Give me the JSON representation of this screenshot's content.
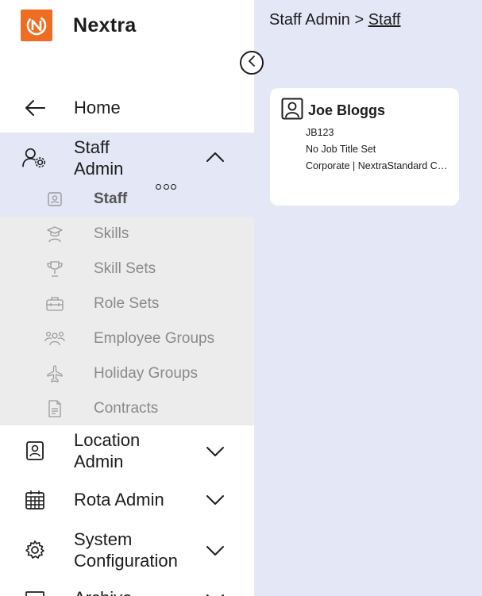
{
  "brand": {
    "name": "Nextra",
    "logo_icon": "nextra-logo-icon",
    "accent": "#ef6d22"
  },
  "sidebar": {
    "collapse_icon": "chevron-left-icon",
    "home": {
      "label": "Home",
      "icon": "arrow-left-icon"
    },
    "staff_admin": {
      "label_line1": "Staff",
      "label_line2": "Admin",
      "icon": "user-gear-icon",
      "expanded": true,
      "submenu": [
        {
          "label": "Staff",
          "icon": "id-badge-icon",
          "active": true
        },
        {
          "label": "Skills",
          "icon": "graduate-icon",
          "active": false
        },
        {
          "label": "Skill Sets",
          "icon": "trophy-icon",
          "active": false
        },
        {
          "label": "Role Sets",
          "icon": "toolbox-icon",
          "active": false
        },
        {
          "label": "Employee Groups",
          "icon": "people-group-icon",
          "active": false
        },
        {
          "label": "Holiday Groups",
          "icon": "airplane-icon",
          "active": false
        },
        {
          "label": "Contracts",
          "icon": "document-icon",
          "active": false
        }
      ]
    },
    "location_admin": {
      "label_line1": "Location",
      "label_line2": "Admin",
      "icon": "contact-card-icon"
    },
    "rota_admin": {
      "label": "Rota Admin",
      "icon": "calendar-icon"
    },
    "system_config": {
      "label_line1": "System",
      "label_line2": "Configuration",
      "icon": "gear-icon"
    },
    "archive": {
      "label": "Archive",
      "icon": "archive-icon"
    }
  },
  "breadcrumb": {
    "parent": "Staff Admin",
    "separator": " > ",
    "current": "Staff"
  },
  "staff_card": {
    "name": "Joe Bloggs",
    "icon": "person-badge-icon",
    "details": [
      "JB123",
      "No Job Title Set",
      "Corporate | NextraStandard Contract"
    ],
    "more_icon": "more-options-icon"
  },
  "colors": {
    "background": "#e3e7f6",
    "sidebar": "#ffffff",
    "submenu_bg": "#ececec",
    "active_group": "#e3e7f6"
  }
}
